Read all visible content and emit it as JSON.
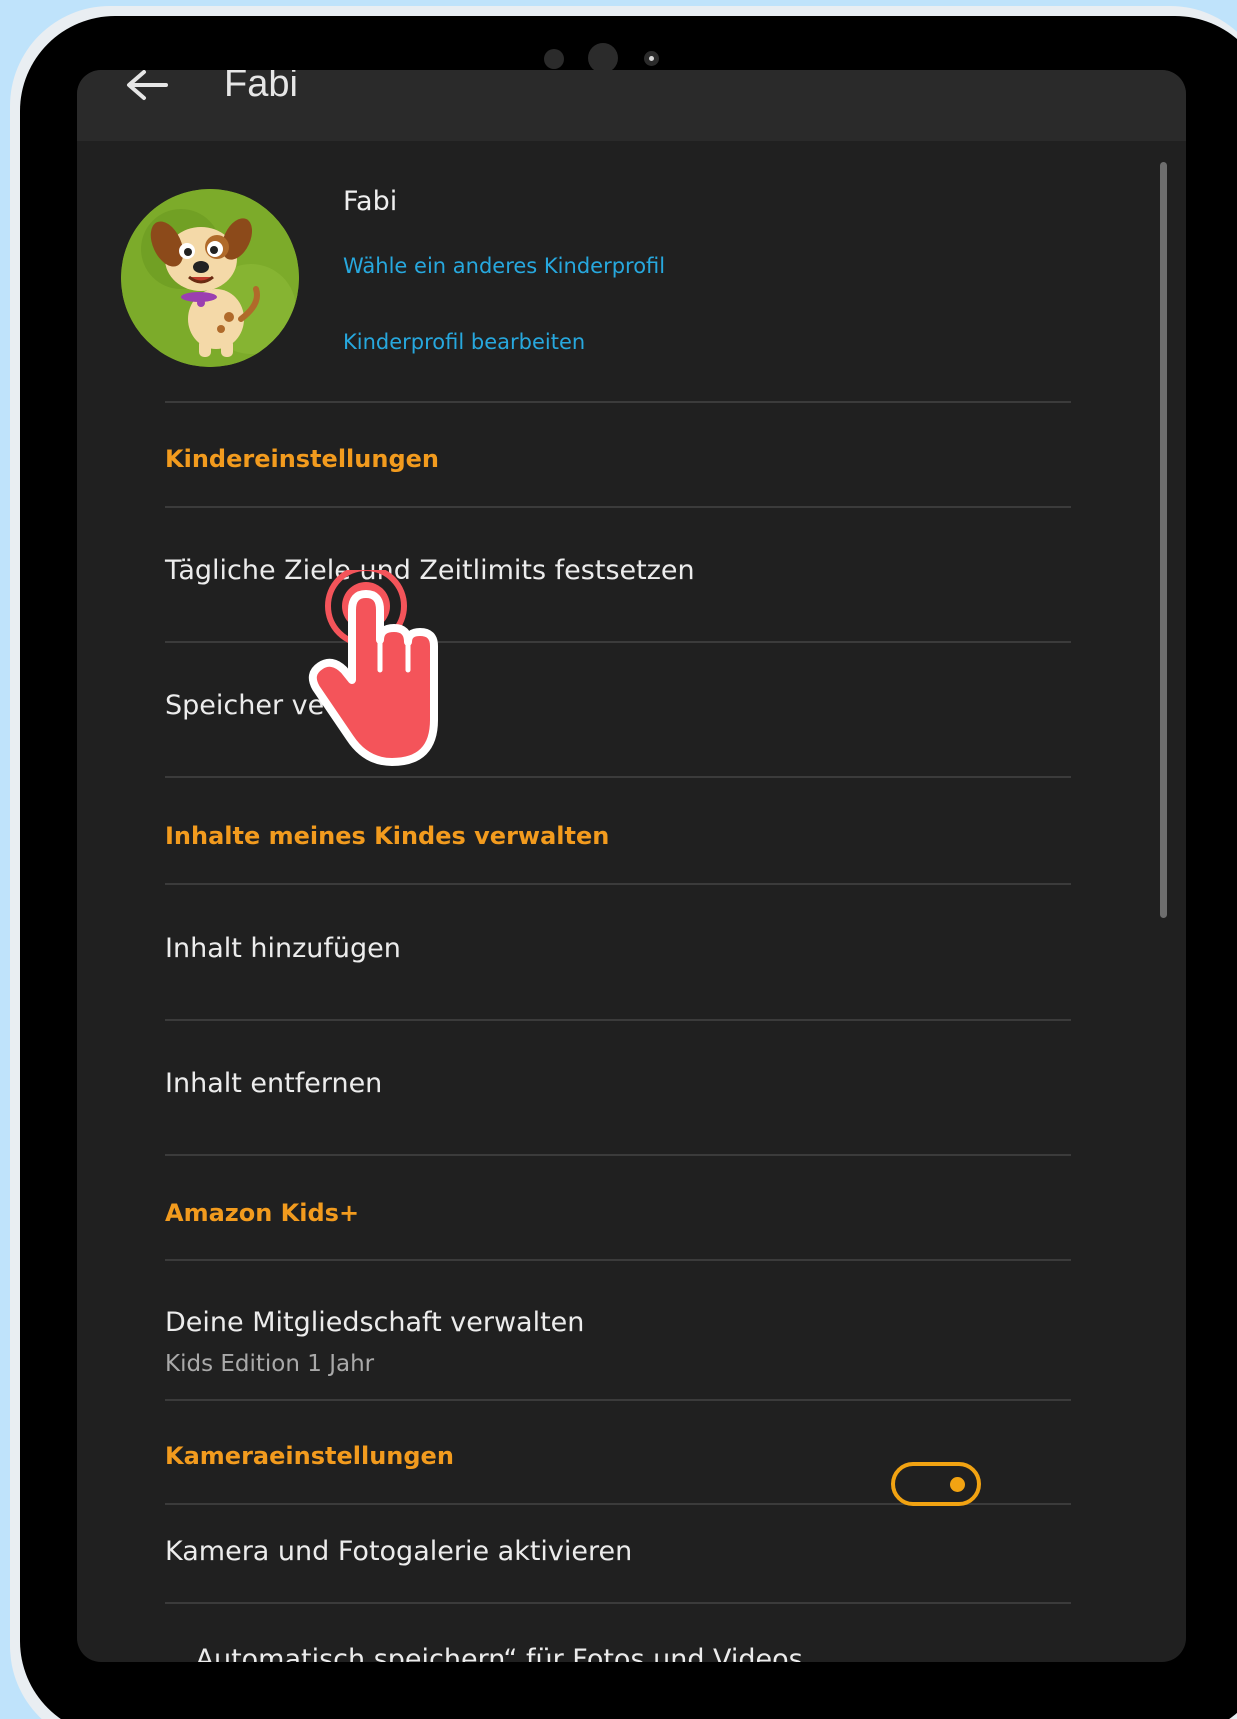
{
  "appbar": {
    "title": "Fabi"
  },
  "profile": {
    "name": "Fabi",
    "links": [
      "Wähle ein anderes Kinderprofil",
      "Kinderprofil bearbeiten"
    ]
  },
  "sections": {
    "kids_settings": "Kindereinstellungen",
    "content": "Inhalte meines Kindes verwalten",
    "kids_plus": "Amazon Kids+",
    "camera": "Kameraeinstellungen"
  },
  "items": {
    "daily_goals": "Tägliche Ziele und Zeitlimits festsetzen",
    "storage": "Speicher ve",
    "add_content": "Inhalt hinzufügen",
    "remove_content": "Inhalt entfernen",
    "membership": "Deine Mitgliedschaft verwalten",
    "membership_sub": "Kids Edition 1 Jahr",
    "camera_toggle": "Kamera und Fotogalerie aktivieren",
    "auto_save": "„Automatisch speichern“ für Fotos und Videos"
  },
  "toggle": {
    "on": true,
    "color": "#f2a312"
  },
  "colors": {
    "accent": "#f29b1e",
    "link": "#27a8de",
    "background": "#202020"
  },
  "icons": [
    "back-arrow-icon",
    "dog-avatar-icon",
    "tap-hand-icon"
  ]
}
